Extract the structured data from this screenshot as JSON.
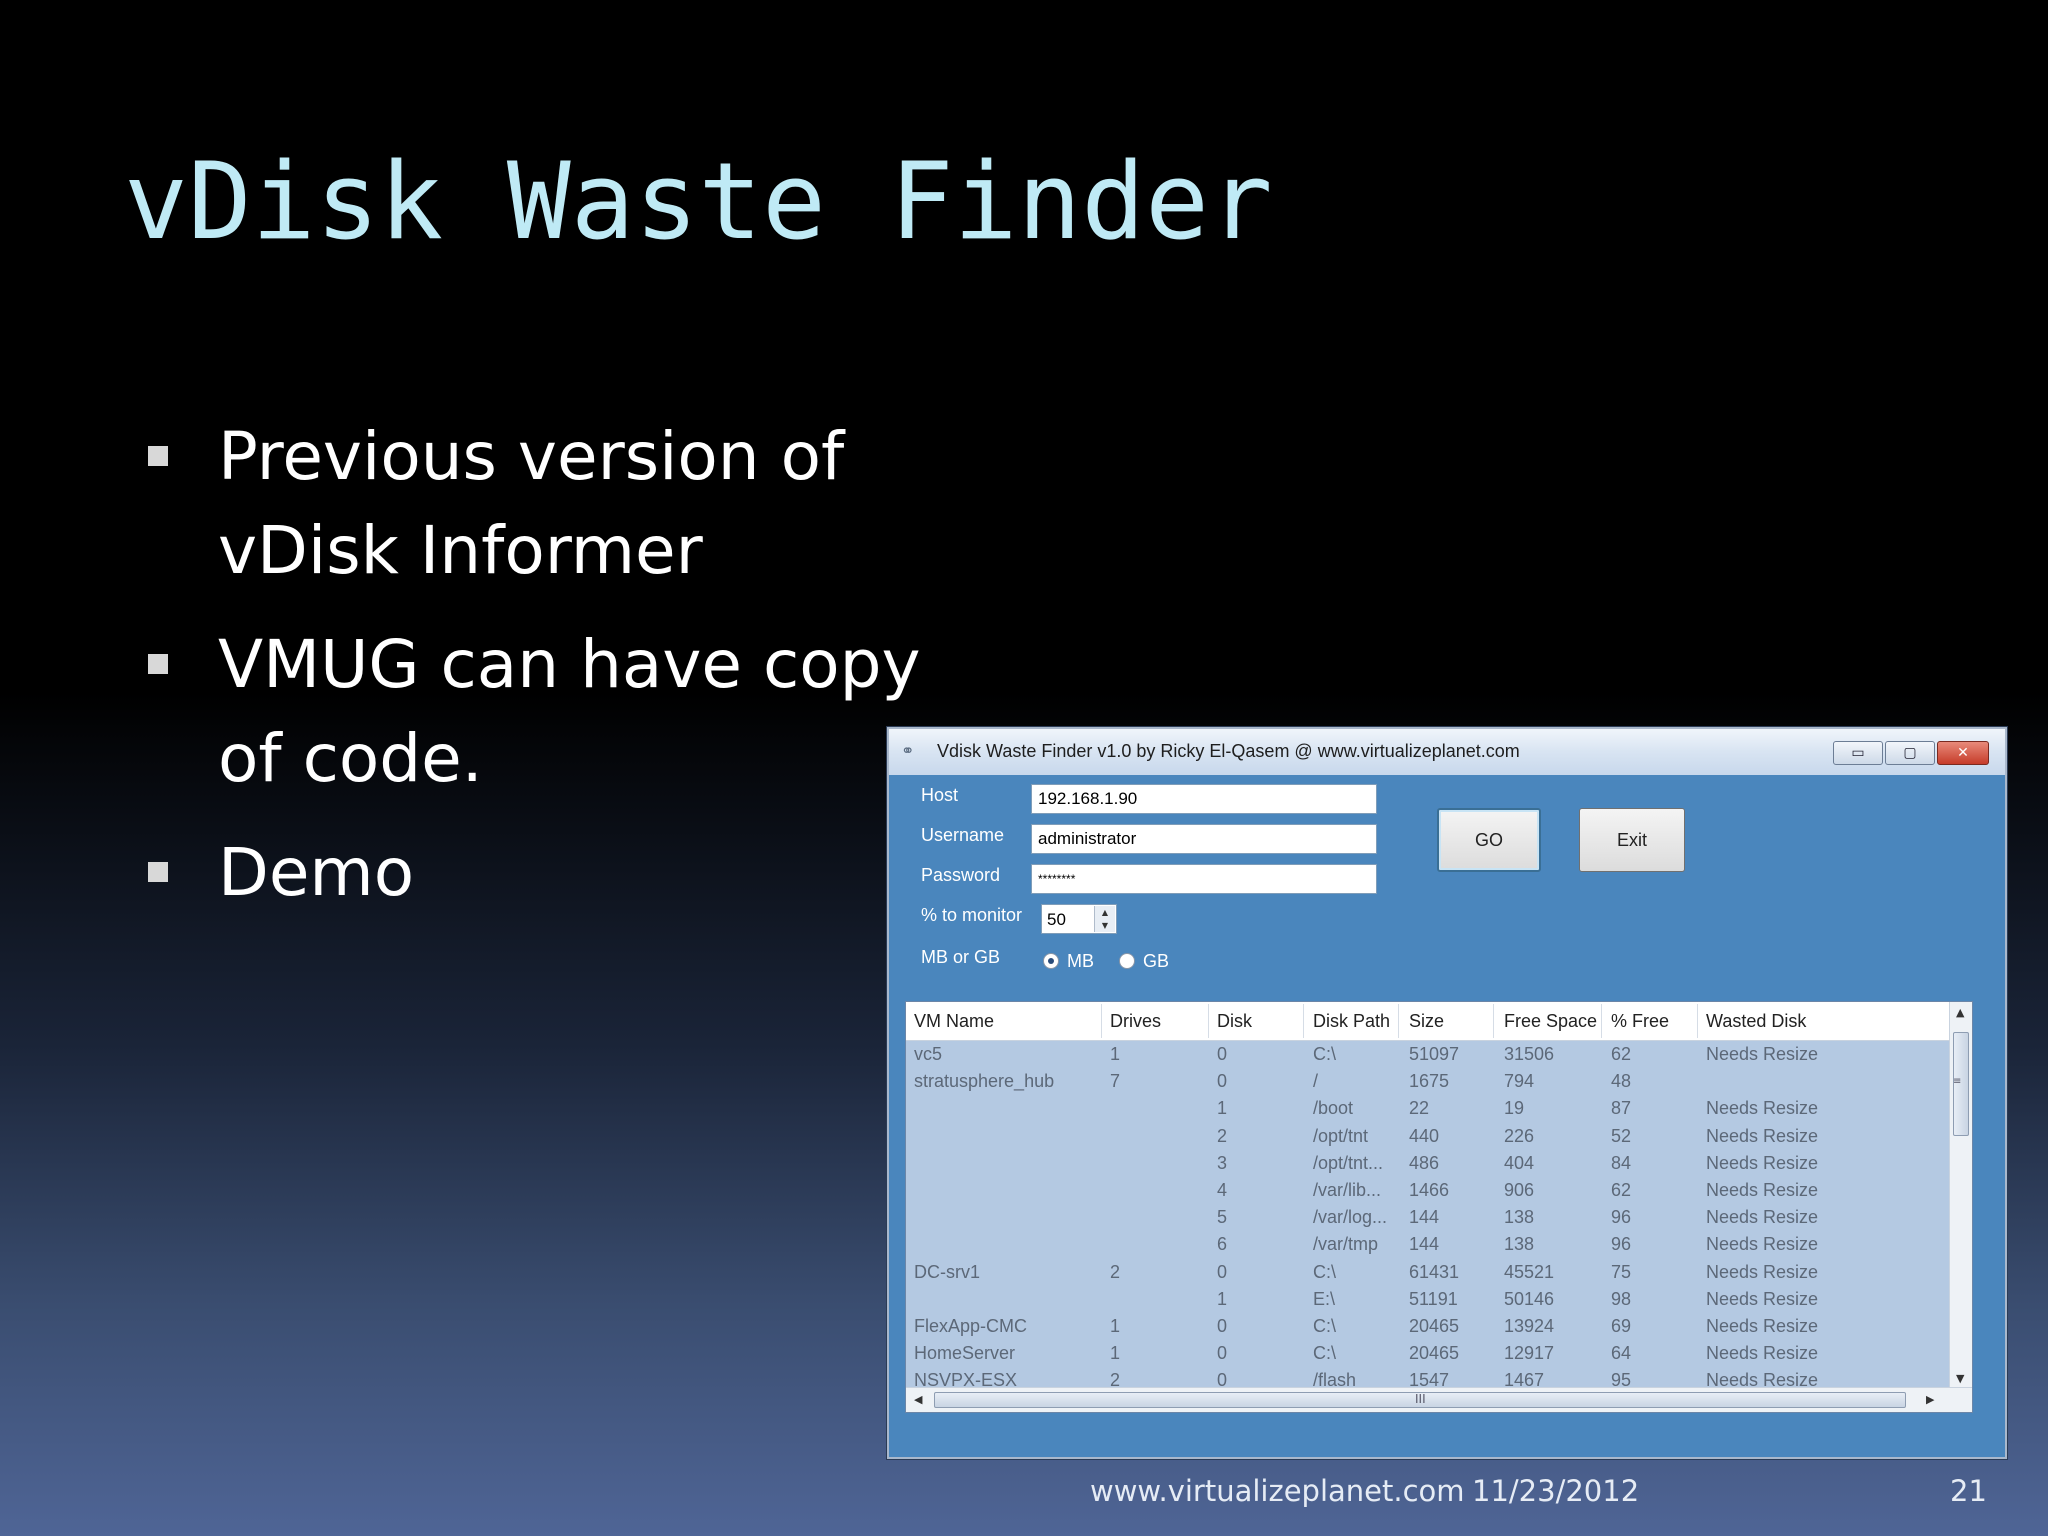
{
  "slide": {
    "title": "vDisk Waste Finder",
    "bullets": [
      "Previous version of\nvDisk Informer",
      "VMUG can have copy\nof code.",
      "Demo"
    ],
    "footer": {
      "url": "www.virtualizeplanet.com",
      "date": "11/23/2012",
      "page": "21"
    }
  },
  "window": {
    "title": "Vdisk Waste Finder v1.0 by Ricky El-Qasem @ www.virtualizeplanet.com",
    "controls": {
      "minimize": "▭",
      "maximize": "▢",
      "close": "✕"
    },
    "form": {
      "host_label": "Host",
      "host_value": "192.168.1.90",
      "username_label": "Username",
      "username_value": "administrator",
      "password_label": "Password",
      "password_value": "********",
      "monitor_label": "% to monitor",
      "monitor_value": "50",
      "unit_label": "MB or GB",
      "unit_options": [
        "MB",
        "GB"
      ],
      "unit_selected": "MB"
    },
    "buttons": {
      "go": "GO",
      "exit": "Exit"
    },
    "grid": {
      "columns": [
        "VM Name",
        "Drives",
        "Disk",
        "Disk Path",
        "Size",
        "Free Space",
        "% Free",
        "Wasted Disk"
      ],
      "rows": [
        [
          "vc5",
          "1",
          "0",
          "C:\\",
          "51097",
          "31506",
          "62",
          "Needs Resize"
        ],
        [
          "stratusphere_hub",
          "7",
          "0",
          "/",
          "1675",
          "794",
          "48",
          ""
        ],
        [
          "",
          "",
          "1",
          "/boot",
          "22",
          "19",
          "87",
          "Needs Resize"
        ],
        [
          "",
          "",
          "2",
          "/opt/tnt",
          "440",
          "226",
          "52",
          "Needs Resize"
        ],
        [
          "",
          "",
          "3",
          "/opt/tnt...",
          "486",
          "404",
          "84",
          "Needs Resize"
        ],
        [
          "",
          "",
          "4",
          "/var/lib...",
          "1466",
          "906",
          "62",
          "Needs Resize"
        ],
        [
          "",
          "",
          "5",
          "/var/log...",
          "144",
          "138",
          "96",
          "Needs Resize"
        ],
        [
          "",
          "",
          "6",
          "/var/tmp",
          "144",
          "138",
          "96",
          "Needs Resize"
        ],
        [
          "DC-srv1",
          "2",
          "0",
          "C:\\",
          "61431",
          "45521",
          "75",
          "Needs Resize"
        ],
        [
          "",
          "",
          "1",
          "E:\\",
          "51191",
          "50146",
          "98",
          "Needs Resize"
        ],
        [
          "FlexApp-CMC",
          "1",
          "0",
          "C:\\",
          "20465",
          "13924",
          "69",
          "Needs Resize"
        ],
        [
          "HomeServer",
          "1",
          "0",
          "C:\\",
          "20465",
          "12917",
          "64",
          "Needs Resize"
        ],
        [
          "NSVPX-ESX",
          "2",
          "0",
          "/flash",
          "1547",
          "1467",
          "95",
          "Needs Resize"
        ]
      ]
    }
  }
}
